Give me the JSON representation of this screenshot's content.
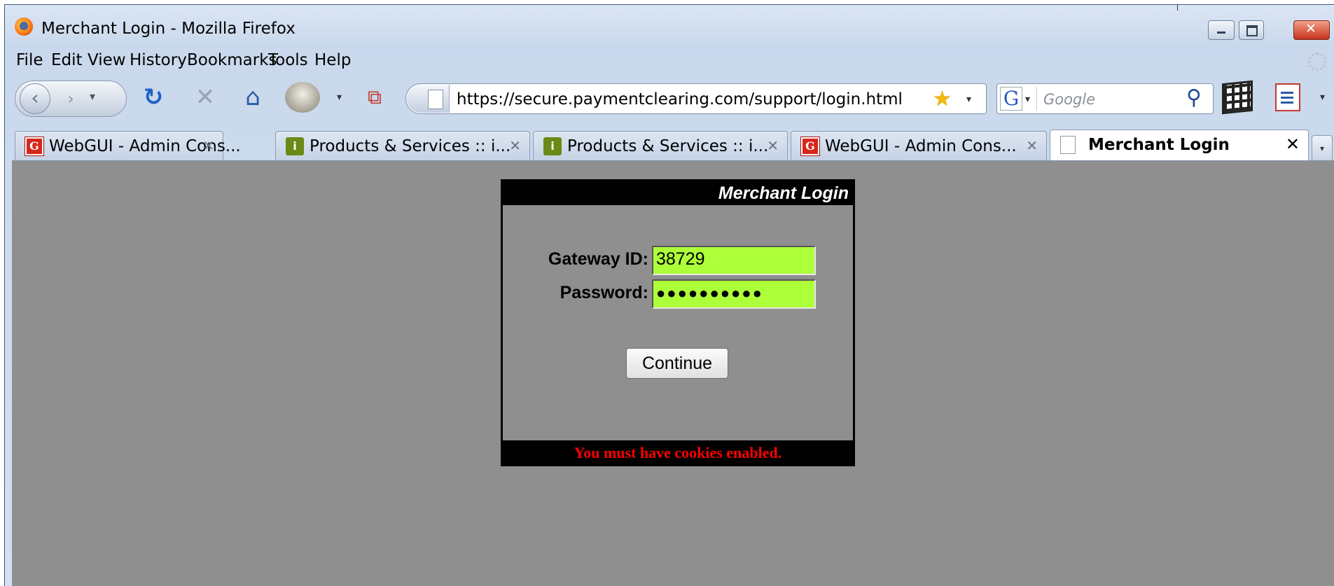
{
  "window": {
    "title": "Merchant Login - Mozilla Firefox",
    "icon": "firefox-icon"
  },
  "menu": {
    "items": [
      "File",
      "Edit",
      "View",
      "History",
      "Bookmarks",
      "Tools",
      "Help"
    ]
  },
  "navbar": {
    "url": "https://secure.paymentclearing.com/support/login.html",
    "search_engine": "G",
    "search_placeholder": "Google"
  },
  "tabs": [
    {
      "label": "WebGUI - Admin Cons...",
      "icon": "webgui-favicon",
      "active": false
    },
    {
      "label": "Products & Services :: i...",
      "icon": "products-favicon",
      "active": false
    },
    {
      "label": "Products & Services :: i...",
      "icon": "products-favicon",
      "active": false
    },
    {
      "label": "WebGUI - Admin Cons...",
      "icon": "webgui-favicon",
      "active": false
    },
    {
      "label": "Merchant Login",
      "icon": "page-icon",
      "active": true
    }
  ],
  "login": {
    "title": "Merchant Login",
    "gateway_label": "Gateway ID:",
    "gateway_value": "38729",
    "password_label": "Password:",
    "password_value": "●●●●●●●●●●",
    "continue_label": "Continue",
    "cookie_warning": "You must have cookies enabled."
  },
  "colors": {
    "page_background": "#8f8f8f",
    "field_background": "#adff3a",
    "warning_text": "#ff0000"
  }
}
